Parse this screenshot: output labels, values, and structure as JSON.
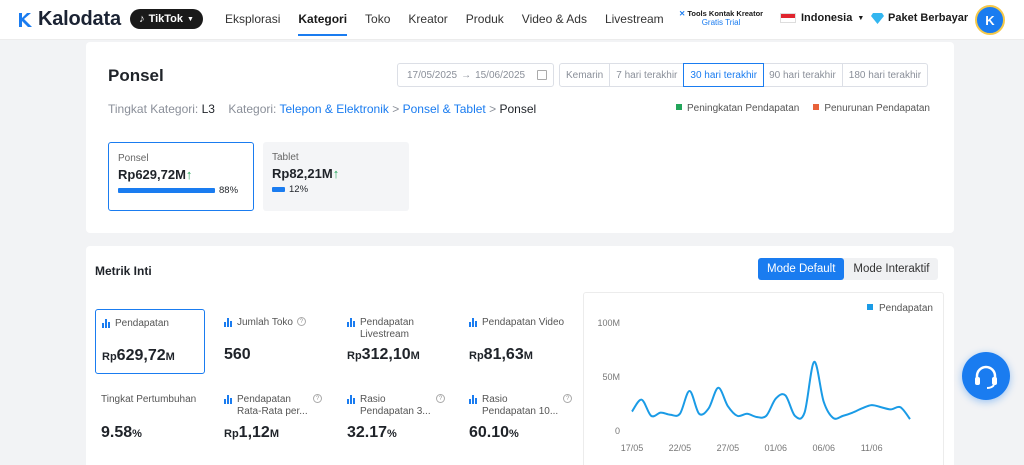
{
  "nav": {
    "brand": "Kalodata",
    "platform": "TikTok",
    "links": [
      "Eksplorasi",
      "Kategori",
      "Toko",
      "Kreator",
      "Produk",
      "Video & Ads",
      "Livestream"
    ],
    "tools_title": "Tools Kontak Kreator",
    "tools_sub": "Gratis Trial",
    "language": "Indonesia",
    "plan": "Paket Berbayar",
    "avatar_initial": "K"
  },
  "header": {
    "title": "Ponsel",
    "date_start": "17/05/2025",
    "date_end": "15/06/2025",
    "ranges": [
      "Kemarin",
      "7 hari terakhir",
      "30 hari terakhir",
      "90 hari terakhir",
      "180 hari terakhir"
    ],
    "selected_range": "30 hari terakhir",
    "level_label": "Tingkat Kategori:",
    "level_value": "L3",
    "category_label": "Kategori:",
    "crumb1": "Telepon & Elektronik",
    "crumb2": "Ponsel & Tablet",
    "crumb3": "Ponsel",
    "sep": ">",
    "legend_up": "Peningkatan Pendapatan",
    "legend_down": "Penurunan Pendapatan",
    "color_up": "#22a55a",
    "color_down": "#e8623a"
  },
  "categories": [
    {
      "name": "Ponsel",
      "value": "Rp629,72M",
      "share": "88%",
      "fraction": 0.88
    },
    {
      "name": "Tablet",
      "value": "Rp82,21M",
      "share": "12%",
      "fraction": 0.12
    }
  ],
  "metrics_panel": {
    "title": "Metrik Inti",
    "mode_default": "Mode Default",
    "mode_interactive": "Mode Interaktif",
    "m1_label": "Pendapatan",
    "m1_prefix": "Rp",
    "m1_value": "629,72",
    "m1_unit": "M",
    "m2_label": "Jumlah Toko",
    "m2_value": "560",
    "m3_label": "Pendapatan Livestream",
    "m3_prefix": "Rp",
    "m3_value": "312,10",
    "m3_unit": "M",
    "m4_label": "Pendapatan Video",
    "m4_prefix": "Rp",
    "m4_value": "81,63",
    "m4_unit": "M",
    "m5_label": "Tingkat Pertumbuhan",
    "m5_value": "9.58",
    "m5_unit": "%",
    "m6_label": "Pendapatan Rata-Rata per...",
    "m6_prefix": "Rp",
    "m6_value": "1,12",
    "m6_unit": "M",
    "m7_label": "Rasio Pendapatan 3...",
    "m7_value": "32.17",
    "m7_unit": "%",
    "m8_label": "Rasio Pendapatan 10...",
    "m8_value": "60.10",
    "m8_unit": "%",
    "help_icon": "?"
  },
  "chart_data": {
    "type": "line",
    "series": [
      {
        "name": "Pendapatan",
        "color": "#1a9be6",
        "values": [
          18,
          29,
          14,
          17,
          15,
          16,
          37,
          16,
          21,
          40,
          23,
          14,
          16,
          13,
          14,
          30,
          33,
          14,
          17,
          64,
          27,
          12,
          14,
          17,
          21,
          24,
          22,
          20,
          22,
          11
        ]
      }
    ],
    "x_tick_labels": [
      "17/05",
      "22/05",
      "27/05",
      "01/06",
      "06/06",
      "11/06"
    ],
    "y_tick_labels": [
      "100M",
      "50M",
      "0"
    ],
    "ylim": [
      0,
      100
    ],
    "y_unit": "M",
    "grid": false,
    "legend": "top-right"
  }
}
